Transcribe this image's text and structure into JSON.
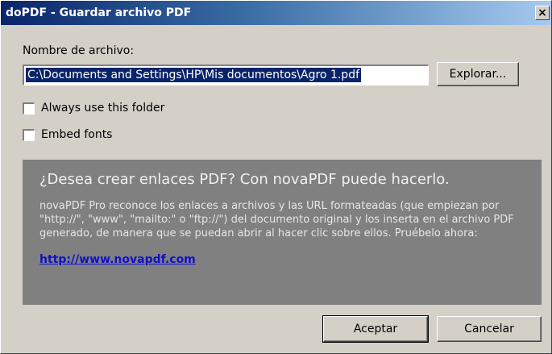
{
  "window": {
    "title": "doPDF - Guardar archivo PDF",
    "close_glyph": "×"
  },
  "form": {
    "filename_label": "Nombre de archivo:",
    "filename_value": "C:\\Documents and Settings\\HP\\Mis documentos\\Agro 1.pdf",
    "browse_label": "Explorar...",
    "always_use_folder_label": "Always use this folder",
    "always_use_folder_checked": false,
    "embed_fonts_label": "Embed fonts",
    "embed_fonts_checked": false
  },
  "promo": {
    "title": "¿Desea crear enlaces PDF? Con novaPDF puede hacerlo.",
    "body": "novaPDF Pro reconoce los enlaces a archivos y las URL formateadas (que empiezan por \"http://\", \"www\", \"mailto:\" o \"ftp://\") del documento original y los inserta en el archivo PDF generado, de manera que se puedan abrir al hacer clic sobre ellos. Pruébelo ahora:",
    "link": "http://www.novapdf.com"
  },
  "buttons": {
    "ok_label": "Aceptar",
    "cancel_label": "Cancelar"
  },
  "colors": {
    "titlebar_start": "#0a246a",
    "titlebar_end": "#a6caf0",
    "dialog_bg": "#d4d0c8",
    "promo_bg": "#808080",
    "link": "#1010c8"
  }
}
